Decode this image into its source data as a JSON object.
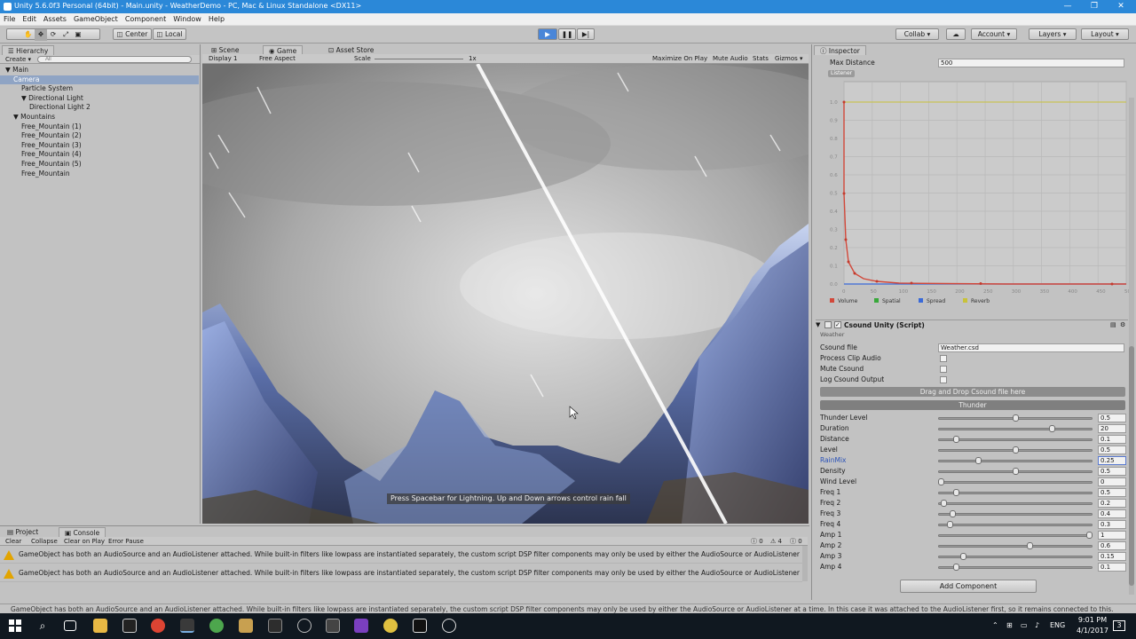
{
  "window": {
    "title": "Unity 5.6.0f3 Personal (64bit) - Main.unity - WeatherDemo - PC, Mac & Linux Standalone <DX11>"
  },
  "menu": [
    "File",
    "Edit",
    "Assets",
    "GameObject",
    "Component",
    "Window",
    "Help"
  ],
  "toolbar": {
    "center": "Center",
    "local": "Local",
    "collab": "Collab ▾",
    "account": "Account ▾",
    "layers": "Layers ▾",
    "layout": "Layout ▾"
  },
  "hierarchy": {
    "tab": "Hierarchy",
    "create": "Create ▾",
    "search_placeholder": "All",
    "items": [
      {
        "label": "▼ Main",
        "indent": 0,
        "selected": false
      },
      {
        "label": "Camera",
        "indent": 1,
        "selected": true
      },
      {
        "label": "Particle System",
        "indent": 2,
        "selected": false
      },
      {
        "label": "▼ Directional Light",
        "indent": 2,
        "selected": false
      },
      {
        "label": "Directional Light 2",
        "indent": 3,
        "selected": false
      },
      {
        "label": "▼ Mountains",
        "indent": 1,
        "selected": false
      },
      {
        "label": "Free_Mountain (1)",
        "indent": 2,
        "selected": false
      },
      {
        "label": "Free_Mountain (2)",
        "indent": 2,
        "selected": false
      },
      {
        "label": "Free_Mountain (3)",
        "indent": 2,
        "selected": false
      },
      {
        "label": "Free_Mountain (4)",
        "indent": 2,
        "selected": false
      },
      {
        "label": "Free_Mountain (5)",
        "indent": 2,
        "selected": false
      },
      {
        "label": "Free_Mountain",
        "indent": 2,
        "selected": false
      }
    ]
  },
  "center_tabs": {
    "scene": "Scene",
    "game": "Game",
    "asset_store": "Asset Store"
  },
  "game_bar": {
    "display": "Display 1",
    "aspect": "Free Aspect",
    "scale": "Scale",
    "scale_value": "1x",
    "maximize": "Maximize On Play",
    "mute": "Mute Audio",
    "stats": "Stats",
    "gizmos": "Gizmos ▾"
  },
  "game_hint": "Press Spacebar for Lightning. Up and Down arrows control rain fall",
  "inspector": {
    "tab": "Inspector",
    "max_distance_label": "Max Distance",
    "max_distance_value": "500",
    "listener_label": "Listener",
    "chart_y_ticks": [
      "1.0",
      "0.9",
      "0.8",
      "0.7",
      "0.6",
      "0.5",
      "0.4",
      "0.3",
      "0.2",
      "0.1",
      "0.0"
    ],
    "chart_x_ticks": [
      "0",
      "50",
      "100",
      "150",
      "200",
      "250",
      "300",
      "350",
      "400",
      "450",
      "500"
    ],
    "legend": [
      {
        "label": "Volume",
        "color": "#d2483a"
      },
      {
        "label": "Spatial",
        "color": "#38a83a"
      },
      {
        "label": "Spread",
        "color": "#3a6ad8"
      },
      {
        "label": "Reverb",
        "color": "#c8c23a"
      }
    ],
    "component_title": "Csound Unity (Script)",
    "component_subtitle": "Weather",
    "csound_file_label": "Csound file",
    "csound_file_value": "Weather.csd",
    "checks": [
      "Process Clip Audio",
      "Mute Csound",
      "Log Csound Output"
    ],
    "drag_drop": "Drag and Drop Csound file here",
    "group": "Thunder",
    "sliders": [
      {
        "label": "Thunder Level",
        "value": "0.5",
        "frac": 0.5
      },
      {
        "label": "Duration",
        "value": "20",
        "frac": 0.75
      },
      {
        "label": "Distance",
        "value": "0.1",
        "frac": 0.1
      },
      {
        "label": "Level",
        "value": "0.5",
        "frac": 0.5
      },
      {
        "label": "RainMix",
        "value": "0.25",
        "frac": 0.25,
        "highlight": true
      },
      {
        "label": "Density",
        "value": "0.5",
        "frac": 0.5
      },
      {
        "label": "Wind Level",
        "value": "0",
        "frac": 0.0
      },
      {
        "label": "Freq 1",
        "value": "0.5",
        "frac": 0.1
      },
      {
        "label": "Freq 2",
        "value": "0.2",
        "frac": 0.02
      },
      {
        "label": "Freq 3",
        "value": "0.4",
        "frac": 0.08
      },
      {
        "label": "Freq 4",
        "value": "0.3",
        "frac": 0.06
      },
      {
        "label": "Amp 1",
        "value": "1",
        "frac": 1.0
      },
      {
        "label": "Amp 2",
        "value": "0.6",
        "frac": 0.6
      },
      {
        "label": "Amp 3",
        "value": "0.15",
        "frac": 0.15
      },
      {
        "label": "Amp 4",
        "value": "0.1",
        "frac": 0.1
      }
    ],
    "add_component": "Add Component"
  },
  "console": {
    "tabs": {
      "project": "Project",
      "console": "Console"
    },
    "buttons": [
      "Clear",
      "Collapse",
      "Clear on Play",
      "Error Pause"
    ],
    "counts": {
      "errors": "0",
      "warnings": "4",
      "infos": "0"
    },
    "messages": [
      "GameObject has both an AudioSource and an AudioListener attached. While built-in filters like lowpass are instantiated separately, the custom script DSP filter components may only be used by either the AudioSource or AudioListener",
      "GameObject has both an AudioSource and an AudioListener attached. While built-in filters like lowpass are instantiated separately, the custom script DSP filter components may only be used by either the AudioSource or AudioListener"
    ]
  },
  "status_bar": "GameObject has both an AudioSource and an AudioListener attached. While built-in filters like lowpass are instantiated separately, the custom script DSP filter components may only be used by either the AudioSource or AudioListener at a time. In this case it was attached to the AudioListener first, so it remains connected to this.",
  "taskbar": {
    "lang": "ENG",
    "time": "9:01 PM",
    "date": "4/1/2017",
    "notif": "3"
  }
}
